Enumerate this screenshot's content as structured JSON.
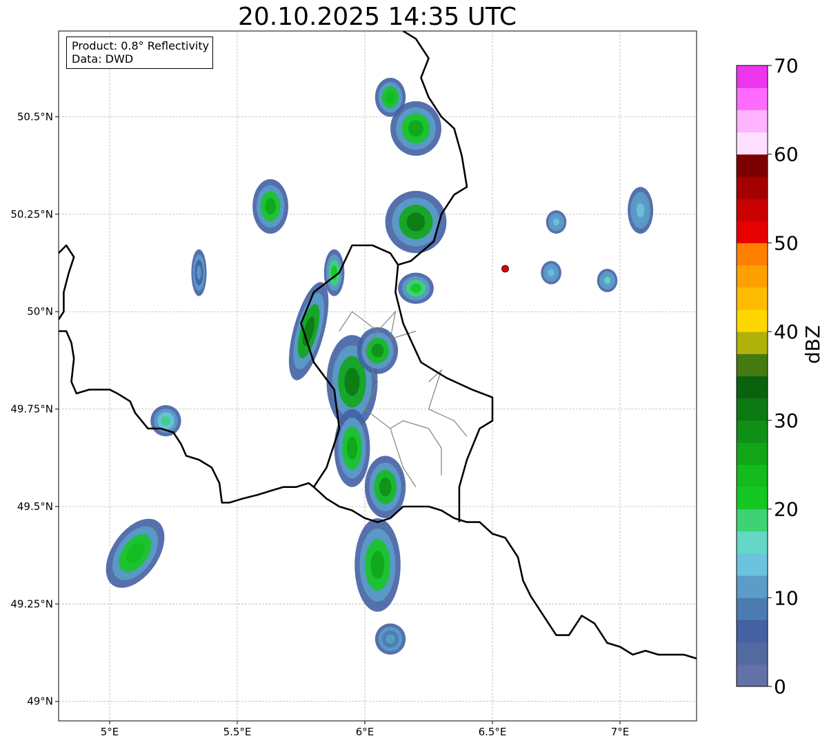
{
  "title": "20.10.2025 14:35 UTC",
  "info_box": {
    "product": "Product: 0.8° Reflectivity",
    "data": "Data: DWD"
  },
  "map": {
    "lon_range": [
      4.8,
      7.3
    ],
    "lat_range": [
      48.95,
      50.72
    ],
    "x_ticks": [
      {
        "value": 5.0,
        "label": "5°E"
      },
      {
        "value": 5.5,
        "label": "5.5°E"
      },
      {
        "value": 6.0,
        "label": "6°E"
      },
      {
        "value": 6.5,
        "label": "6.5°E"
      },
      {
        "value": 7.0,
        "label": "7°E"
      }
    ],
    "y_ticks": [
      {
        "value": 50.5,
        "label": "50.5°N"
      },
      {
        "value": 50.25,
        "label": "50.25°N"
      },
      {
        "value": 50.0,
        "label": "50°N"
      },
      {
        "value": 49.75,
        "label": "49.75°N"
      },
      {
        "value": 49.5,
        "label": "49.5°N"
      },
      {
        "value": 49.25,
        "label": "49.25°N"
      },
      {
        "value": 49.0,
        "label": "49°N"
      }
    ],
    "grid": true,
    "radar_site": {
      "lon": 6.55,
      "lat": 50.11,
      "color": "#e00000"
    }
  },
  "colorbar": {
    "label": "dBZ",
    "min": 0,
    "max": 70,
    "ticks": [
      {
        "value": 0,
        "label": "0"
      },
      {
        "value": 10,
        "label": "10"
      },
      {
        "value": 20,
        "label": "20"
      },
      {
        "value": 30,
        "label": "30"
      },
      {
        "value": 40,
        "label": "40"
      },
      {
        "value": 50,
        "label": "50"
      },
      {
        "value": 60,
        "label": "60"
      },
      {
        "value": 70,
        "label": "70"
      }
    ],
    "colors": [
      "#6272a6",
      "#536aa0",
      "#4361a3",
      "#4b7bb1",
      "#5b9cc8",
      "#6bc3dd",
      "#65d7c6",
      "#3dd375",
      "#15c721",
      "#13bb1d",
      "#10a618",
      "#0f8f16",
      "#0c7a12",
      "#0a620f",
      "#447a10",
      "#b0b20a",
      "#ffd700",
      "#ffbb00",
      "#ffa000",
      "#ff8000",
      "#e60000",
      "#c80000",
      "#a50000",
      "#7d0000",
      "#ffdfff",
      "#ffb4ff",
      "#ff6aff",
      "#ed35ed"
    ]
  },
  "echo_cells": [
    {
      "lon": 5.1,
      "lat": 49.38,
      "rx": 0.09,
      "ry": 0.1,
      "intensity": 24,
      "rot": 35
    },
    {
      "lon": 5.22,
      "lat": 49.72,
      "rx": 0.06,
      "ry": 0.04,
      "intensity": 18,
      "rot": 0
    },
    {
      "lon": 5.63,
      "lat": 50.27,
      "rx": 0.07,
      "ry": 0.07,
      "intensity": 26,
      "rot": 0
    },
    {
      "lon": 5.78,
      "lat": 49.95,
      "rx": 0.06,
      "ry": 0.13,
      "intensity": 30,
      "rot": 15
    },
    {
      "lon": 5.88,
      "lat": 50.1,
      "rx": 0.04,
      "ry": 0.06,
      "intensity": 22,
      "rot": 0
    },
    {
      "lon": 5.95,
      "lat": 49.82,
      "rx": 0.1,
      "ry": 0.12,
      "intensity": 30,
      "rot": 0
    },
    {
      "lon": 6.05,
      "lat": 49.9,
      "rx": 0.08,
      "ry": 0.06,
      "intensity": 28,
      "rot": 0
    },
    {
      "lon": 5.95,
      "lat": 49.65,
      "rx": 0.07,
      "ry": 0.1,
      "intensity": 26,
      "rot": 0
    },
    {
      "lon": 6.08,
      "lat": 49.55,
      "rx": 0.08,
      "ry": 0.08,
      "intensity": 28,
      "rot": 0
    },
    {
      "lon": 6.05,
      "lat": 49.35,
      "rx": 0.09,
      "ry": 0.12,
      "intensity": 26,
      "rot": 0
    },
    {
      "lon": 6.1,
      "lat": 49.16,
      "rx": 0.06,
      "ry": 0.04,
      "intensity": 12,
      "rot": 0
    },
    {
      "lon": 6.2,
      "lat": 50.23,
      "rx": 0.12,
      "ry": 0.08,
      "intensity": 30,
      "rot": 0
    },
    {
      "lon": 6.2,
      "lat": 50.06,
      "rx": 0.07,
      "ry": 0.04,
      "intensity": 22,
      "rot": 0
    },
    {
      "lon": 6.1,
      "lat": 50.55,
      "rx": 0.06,
      "ry": 0.05,
      "intensity": 24,
      "rot": 0
    },
    {
      "lon": 6.2,
      "lat": 50.47,
      "rx": 0.1,
      "ry": 0.07,
      "intensity": 26,
      "rot": 0
    },
    {
      "lon": 6.95,
      "lat": 50.08,
      "rx": 0.04,
      "ry": 0.03,
      "intensity": 16,
      "rot": 0
    },
    {
      "lon": 7.08,
      "lat": 50.26,
      "rx": 0.05,
      "ry": 0.06,
      "intensity": 14,
      "rot": 0
    },
    {
      "lon": 6.75,
      "lat": 50.23,
      "rx": 0.04,
      "ry": 0.03,
      "intensity": 14,
      "rot": 0
    },
    {
      "lon": 6.73,
      "lat": 50.1,
      "rx": 0.04,
      "ry": 0.03,
      "intensity": 14,
      "rot": 0
    },
    {
      "lon": 5.35,
      "lat": 50.1,
      "rx": 0.03,
      "ry": 0.06,
      "intensity": 10,
      "rot": 0
    }
  ],
  "borders": {
    "national": [
      [
        [
          4.8,
          50.15
        ],
        [
          4.83,
          50.17
        ],
        [
          4.86,
          50.14
        ],
        [
          4.84,
          50.1
        ],
        [
          4.82,
          50.05
        ],
        [
          4.82,
          50.0
        ],
        [
          4.8,
          49.98
        ]
      ],
      [
        [
          4.8,
          49.95
        ],
        [
          4.83,
          49.95
        ],
        [
          4.85,
          49.92
        ],
        [
          4.86,
          49.88
        ],
        [
          4.85,
          49.82
        ],
        [
          4.87,
          49.79
        ],
        [
          4.92,
          49.8
        ],
        [
          4.97,
          49.8
        ],
        [
          5.0,
          49.8
        ],
        [
          5.03,
          49.79
        ],
        [
          5.08,
          49.77
        ],
        [
          5.1,
          49.74
        ],
        [
          5.15,
          49.7
        ],
        [
          5.2,
          49.7
        ],
        [
          5.25,
          49.69
        ],
        [
          5.28,
          49.66
        ],
        [
          5.3,
          49.63
        ],
        [
          5.35,
          49.62
        ],
        [
          5.4,
          49.6
        ],
        [
          5.43,
          49.56
        ],
        [
          5.44,
          49.51
        ],
        [
          5.47,
          49.51
        ],
        [
          5.52,
          49.52
        ],
        [
          5.58,
          49.53
        ],
        [
          5.63,
          49.54
        ],
        [
          5.68,
          49.55
        ],
        [
          5.73,
          49.55
        ],
        [
          5.78,
          49.56
        ],
        [
          5.8,
          49.55
        ],
        [
          5.85,
          49.52
        ],
        [
          5.9,
          49.5
        ],
        [
          5.95,
          49.49
        ],
        [
          6.0,
          49.47
        ],
        [
          6.05,
          49.46
        ],
        [
          6.1,
          49.47
        ],
        [
          6.15,
          49.5
        ],
        [
          6.2,
          49.5
        ],
        [
          6.25,
          49.5
        ],
        [
          6.3,
          49.49
        ],
        [
          6.35,
          49.47
        ],
        [
          6.4,
          49.46
        ],
        [
          6.45,
          49.46
        ],
        [
          6.5,
          49.43
        ],
        [
          6.55,
          49.42
        ],
        [
          6.6,
          49.37
        ],
        [
          6.62,
          49.31
        ],
        [
          6.65,
          49.27
        ],
        [
          6.7,
          49.22
        ],
        [
          6.75,
          49.17
        ],
        [
          6.8,
          49.17
        ],
        [
          6.85,
          49.22
        ],
        [
          6.9,
          49.2
        ],
        [
          6.95,
          49.15
        ],
        [
          7.0,
          49.14
        ],
        [
          7.05,
          49.12
        ],
        [
          7.1,
          49.13
        ],
        [
          7.15,
          49.12
        ],
        [
          7.2,
          49.12
        ],
        [
          7.25,
          49.12
        ],
        [
          7.3,
          49.11
        ]
      ],
      [
        [
          5.8,
          49.55
        ],
        [
          5.85,
          49.6
        ],
        [
          5.9,
          49.7
        ],
        [
          5.88,
          49.8
        ],
        [
          5.8,
          49.87
        ],
        [
          5.75,
          49.97
        ],
        [
          5.8,
          50.05
        ],
        [
          5.9,
          50.1
        ],
        [
          5.95,
          50.17
        ],
        [
          6.03,
          50.17
        ],
        [
          6.1,
          50.15
        ],
        [
          6.13,
          50.12
        ],
        [
          6.12,
          50.05
        ],
        [
          6.15,
          49.97
        ],
        [
          6.22,
          49.87
        ],
        [
          6.32,
          49.83
        ],
        [
          6.42,
          49.8
        ],
        [
          6.5,
          49.78
        ],
        [
          6.5,
          49.72
        ],
        [
          6.45,
          49.7
        ],
        [
          6.4,
          49.62
        ],
        [
          6.37,
          49.55
        ],
        [
          6.37,
          49.46
        ]
      ],
      [
        [
          6.13,
          50.12
        ],
        [
          6.18,
          50.13
        ],
        [
          6.27,
          50.18
        ],
        [
          6.3,
          50.25
        ],
        [
          6.35,
          50.3
        ],
        [
          6.4,
          50.32
        ],
        [
          6.38,
          50.4
        ],
        [
          6.35,
          50.47
        ],
        [
          6.3,
          50.5
        ],
        [
          6.25,
          50.55
        ],
        [
          6.22,
          50.6
        ],
        [
          6.25,
          50.65
        ],
        [
          6.2,
          50.7
        ],
        [
          6.15,
          50.72
        ]
      ]
    ],
    "regional": [
      [
        [
          5.9,
          49.95
        ],
        [
          5.95,
          50.0
        ],
        [
          6.05,
          49.95
        ],
        [
          6.12,
          50.0
        ],
        [
          6.1,
          49.93
        ],
        [
          6.2,
          49.95
        ]
      ],
      [
        [
          6.05,
          49.95
        ],
        [
          6.0,
          49.9
        ],
        [
          6.05,
          49.82
        ],
        [
          6.0,
          49.75
        ],
        [
          6.1,
          49.7
        ],
        [
          6.15,
          49.72
        ]
      ],
      [
        [
          6.25,
          49.82
        ],
        [
          6.3,
          49.85
        ],
        [
          6.25,
          49.75
        ],
        [
          6.35,
          49.72
        ],
        [
          6.4,
          49.68
        ]
      ],
      [
        [
          6.15,
          49.72
        ],
        [
          6.25,
          49.7
        ],
        [
          6.3,
          49.65
        ],
        [
          6.3,
          49.58
        ]
      ],
      [
        [
          6.1,
          49.7
        ],
        [
          6.15,
          49.6
        ],
        [
          6.2,
          49.55
        ]
      ]
    ]
  }
}
